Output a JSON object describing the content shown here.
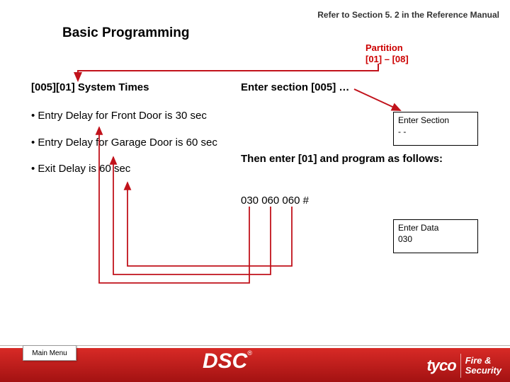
{
  "header": {
    "reference": "Refer to Section 5. 2 in the Reference Manual",
    "title": "Basic Programming"
  },
  "partition": {
    "line1": "Partition",
    "line2": "[01] – [08]"
  },
  "left": {
    "subhead": "[005][01] System Times",
    "b1": "• Entry Delay for Front Door is 30 sec",
    "b2": "• Entry Delay for Garage Door is 60 sec",
    "b3": "• Exit Delay is 60 sec"
  },
  "right": {
    "enter_head": "Enter section [005] …",
    "then_enter": "Then enter [01] and program as follows:",
    "data_string": "030 060 060  #"
  },
  "boxes": {
    "enter_section_label": "Enter Section",
    "enter_section_cursor": "- -",
    "enter_data_label": "Enter Data",
    "enter_data_cursor": "030"
  },
  "footer": {
    "main_menu": "Main Menu",
    "dsc": "DSC",
    "reg": "®",
    "tyco": "tyco",
    "fs_line1": "Fire &",
    "fs_line2": "Security"
  },
  "colors": {
    "arrow_red": "#c1121b"
  }
}
